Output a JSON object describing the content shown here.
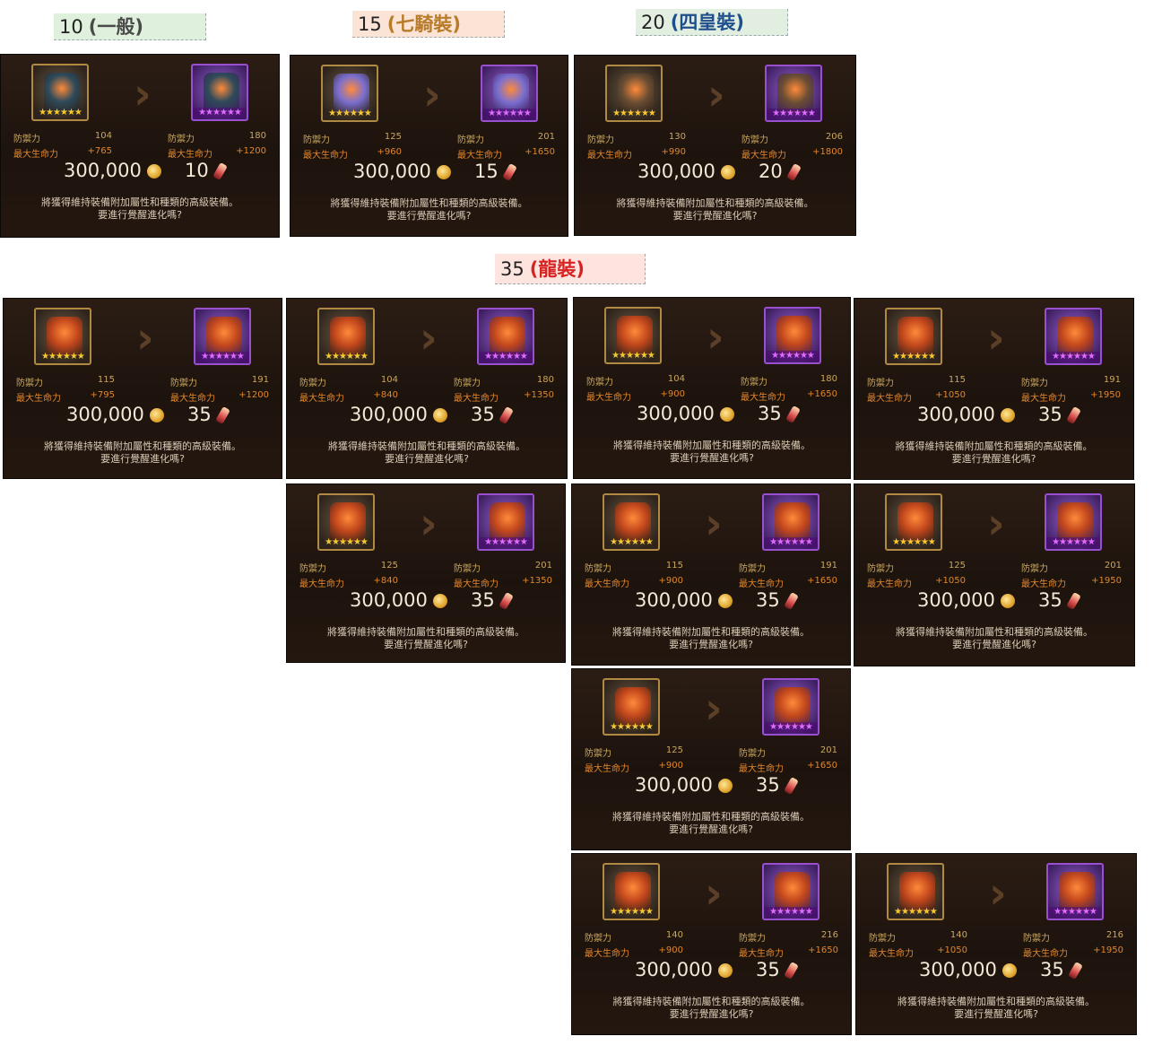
{
  "labels": [
    {
      "num": "10",
      "grade": "(一般)",
      "grade_color": "#4a4a4a",
      "bg": "#dff0dc"
    },
    {
      "num": "15",
      "grade": "(七騎裝)",
      "grade_color": "#b87b2a",
      "bg": "#fbe3d6"
    },
    {
      "num": "20",
      "grade": "(四皇裝)",
      "grade_color": "#1f4e8c",
      "bg": "#e2efe0"
    },
    {
      "num": "35",
      "grade": "(龍裝)",
      "grade_color": "#d62424",
      "bg": "#fde4de"
    }
  ],
  "common": {
    "defense_label": "防禦力",
    "hp_label": "最大生命力",
    "gold_cost": "300,000",
    "desc_line1": "將獲得維持裝備附加屬性和種類的高級裝備。",
    "desc_line2": "要進行覺醒進化嗎?",
    "src_stars": "★★★★★★",
    "dst_stars": "★★★★★★"
  },
  "panels": [
    {
      "item_icon": "gauntlet-icon",
      "art_color": "#2f4b5a",
      "def_from": "104",
      "hp_from": "+765",
      "def_to": "180",
      "hp_to": "+1200",
      "scrolls": "10"
    },
    {
      "item_icon": "knight-chest-icon",
      "art_color": "#7b6fd0",
      "def_from": "125",
      "hp_from": "+960",
      "def_to": "201",
      "hp_to": "+1650",
      "scrolls": "15"
    },
    {
      "item_icon": "emperor-armor-icon",
      "art_color": "#6b4e33",
      "def_from": "130",
      "hp_from": "+990",
      "def_to": "206",
      "hp_to": "+1800",
      "scrolls": "20"
    },
    {
      "item_icon": "dragon-armor-icon",
      "art_color": "#c2471c",
      "def_from": "115",
      "hp_from": "+795",
      "def_to": "191",
      "hp_to": "+1200",
      "scrolls": "35"
    },
    {
      "item_icon": "dragon-armor-icon",
      "art_color": "#c2471c",
      "def_from": "104",
      "hp_from": "+840",
      "def_to": "180",
      "hp_to": "+1350",
      "scrolls": "35"
    },
    {
      "item_icon": "dragon-armor-icon",
      "art_color": "#c2471c",
      "def_from": "104",
      "hp_from": "+900",
      "def_to": "180",
      "hp_to": "+1650",
      "scrolls": "35"
    },
    {
      "item_icon": "dragon-armor-icon",
      "art_color": "#c2471c",
      "def_from": "115",
      "hp_from": "+1050",
      "def_to": "191",
      "hp_to": "+1950",
      "scrolls": "35"
    },
    {
      "item_icon": "dragon-armor-icon",
      "art_color": "#c2471c",
      "def_from": "125",
      "hp_from": "+840",
      "def_to": "201",
      "hp_to": "+1350",
      "scrolls": "35"
    },
    {
      "item_icon": "dragon-armor-icon",
      "art_color": "#c2471c",
      "def_from": "115",
      "hp_from": "+900",
      "def_to": "191",
      "hp_to": "+1650",
      "scrolls": "35"
    },
    {
      "item_icon": "dragon-armor-icon",
      "art_color": "#c2471c",
      "def_from": "125",
      "hp_from": "+1050",
      "def_to": "201",
      "hp_to": "+1950",
      "scrolls": "35"
    },
    {
      "item_icon": "dragon-armor-icon",
      "art_color": "#c2471c",
      "def_from": "125",
      "hp_from": "+900",
      "def_to": "201",
      "hp_to": "+1650",
      "scrolls": "35"
    },
    {
      "item_icon": "dragon-armor-icon",
      "art_color": "#c2471c",
      "def_from": "140",
      "hp_from": "+900",
      "def_to": "216",
      "hp_to": "+1650",
      "scrolls": "35"
    },
    {
      "item_icon": "dragon-armor-icon",
      "art_color": "#c2471c",
      "def_from": "140",
      "hp_from": "+1050",
      "def_to": "216",
      "hp_to": "+1950",
      "scrolls": "35"
    }
  ]
}
